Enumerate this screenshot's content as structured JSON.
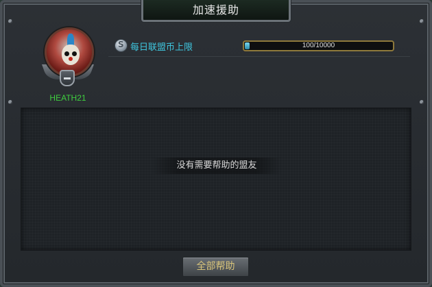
{
  "window": {
    "title": "加速援助"
  },
  "player": {
    "name": "HEATH21"
  },
  "alliance_coin": {
    "icon": "alliance-coin-icon",
    "label": "每日联盟币上限",
    "current": 100,
    "max": 10000,
    "display": "100/10000"
  },
  "helper_list": {
    "empty_text": "没有需要帮助的盟友"
  },
  "actions": {
    "help_all_label": "全部帮助"
  },
  "colors": {
    "player_name": "#3fcf3f",
    "coin_label": "#3fc7e0",
    "button_text": "#d8c47a"
  }
}
